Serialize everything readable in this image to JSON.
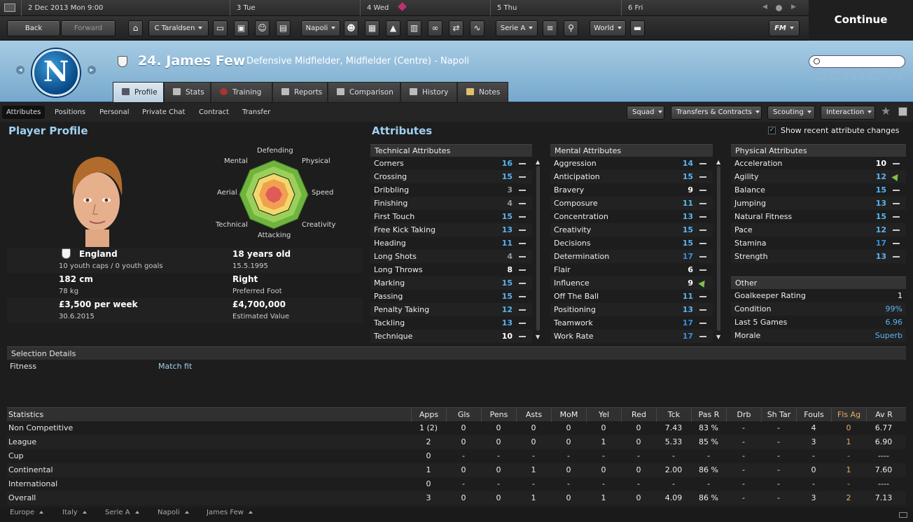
{
  "datebar": {
    "current": "2 Dec 2013 Mon 9:00",
    "days": [
      "3 Tue",
      "4 Wed",
      "5 Thu",
      "6 Fri"
    ]
  },
  "toolbar": {
    "back": "Back",
    "forward": "Forward",
    "manager": "C Taraldsen",
    "club": "Napoli",
    "league": "Serie A",
    "world": "World",
    "fm": "FM",
    "continue": "Continue"
  },
  "player": {
    "title": "24. James Few",
    "subtitle": "Defensive Midfielder, Midfielder (Centre) - Napoli",
    "club_initial": "N",
    "watermark": "SERIE A"
  },
  "tabs": [
    {
      "label": "Profile",
      "active": true
    },
    {
      "label": "Stats"
    },
    {
      "label": "Training"
    },
    {
      "label": "Reports"
    },
    {
      "label": "Comparison"
    },
    {
      "label": "History"
    },
    {
      "label": "Notes"
    }
  ],
  "subnav": [
    "Attributes",
    "Positions",
    "Personal",
    "Private Chat",
    "Contract",
    "Transfer"
  ],
  "subnav_buttons": [
    "Squad",
    "Transfers & Contracts",
    "Scouting",
    "Interaction"
  ],
  "profile": {
    "heading": "Player Profile",
    "radar_labels": {
      "defending": "Defending",
      "physical": "Physical",
      "speed": "Speed",
      "creativity": "Creativity",
      "attacking": "Attacking",
      "technical": "Technical",
      "aerial": "Aerial",
      "mental": "Mental"
    },
    "nationality": "England",
    "caps": "10 youth caps / 0 youth goals",
    "age": "18 years old",
    "dob": "15.5.1995",
    "height": "182 cm",
    "weight": "78 kg",
    "foot": "Right",
    "foot_label": "Preferred Foot",
    "wage": "£3,500 per week",
    "contract_end": "30.6.2015",
    "value": "£4,700,000",
    "value_label": "Estimated Value"
  },
  "attributes": {
    "heading": "Attributes",
    "show_changes": "Show recent attribute changes",
    "technical": {
      "title": "Technical Attributes",
      "rows": [
        {
          "name": "Corners",
          "value": "16",
          "color": "#5ab4f0",
          "trend": "flat"
        },
        {
          "name": "Crossing",
          "value": "15",
          "color": "#5ab4f0",
          "trend": "flat"
        },
        {
          "name": "Dribbling",
          "value": "3",
          "color": "#999999",
          "trend": "flat"
        },
        {
          "name": "Finishing",
          "value": "4",
          "color": "#999999",
          "trend": "flat"
        },
        {
          "name": "First Touch",
          "value": "15",
          "color": "#5ab4f0",
          "trend": "flat"
        },
        {
          "name": "Free Kick Taking",
          "value": "13",
          "color": "#5ab4f0",
          "trend": "flat"
        },
        {
          "name": "Heading",
          "value": "11",
          "color": "#5ab4f0",
          "trend": "flat"
        },
        {
          "name": "Long Shots",
          "value": "4",
          "color": "#999999",
          "trend": "flat"
        },
        {
          "name": "Long Throws",
          "value": "8",
          "color": "#ffffff",
          "trend": "flat"
        },
        {
          "name": "Marking",
          "value": "15",
          "color": "#5ab4f0",
          "trend": "flat"
        },
        {
          "name": "Passing",
          "value": "15",
          "color": "#5ab4f0",
          "trend": "flat"
        },
        {
          "name": "Penalty Taking",
          "value": "12",
          "color": "#5ab4f0",
          "trend": "flat"
        },
        {
          "name": "Tackling",
          "value": "13",
          "color": "#5ab4f0",
          "trend": "flat"
        },
        {
          "name": "Technique",
          "value": "10",
          "color": "#ffffff",
          "trend": "flat"
        }
      ]
    },
    "mental": {
      "title": "Mental Attributes",
      "rows": [
        {
          "name": "Aggression",
          "value": "14",
          "color": "#5ab4f0",
          "trend": "flat"
        },
        {
          "name": "Anticipation",
          "value": "15",
          "color": "#5ab4f0",
          "trend": "flat"
        },
        {
          "name": "Bravery",
          "value": "9",
          "color": "#ffffff",
          "trend": "flat"
        },
        {
          "name": "Composure",
          "value": "11",
          "color": "#5ab4f0",
          "trend": "flat"
        },
        {
          "name": "Concentration",
          "value": "13",
          "color": "#5ab4f0",
          "trend": "flat"
        },
        {
          "name": "Creativity",
          "value": "15",
          "color": "#5ab4f0",
          "trend": "flat"
        },
        {
          "name": "Decisions",
          "value": "15",
          "color": "#5ab4f0",
          "trend": "flat"
        },
        {
          "name": "Determination",
          "value": "17",
          "color": "#3a8ee0",
          "trend": "flat"
        },
        {
          "name": "Flair",
          "value": "6",
          "color": "#ffffff",
          "trend": "flat"
        },
        {
          "name": "Influence",
          "value": "9",
          "color": "#ffffff",
          "trend": "up"
        },
        {
          "name": "Off The Ball",
          "value": "11",
          "color": "#5ab4f0",
          "trend": "flat"
        },
        {
          "name": "Positioning",
          "value": "13",
          "color": "#5ab4f0",
          "trend": "flat"
        },
        {
          "name": "Teamwork",
          "value": "17",
          "color": "#3a8ee0",
          "trend": "flat"
        },
        {
          "name": "Work Rate",
          "value": "17",
          "color": "#3a8ee0",
          "trend": "flat"
        }
      ]
    },
    "physical": {
      "title": "Physical Attributes",
      "rows": [
        {
          "name": "Acceleration",
          "value": "10",
          "color": "#ffffff",
          "trend": "flat"
        },
        {
          "name": "Agility",
          "value": "12",
          "color": "#5ab4f0",
          "trend": "up"
        },
        {
          "name": "Balance",
          "value": "15",
          "color": "#5ab4f0",
          "trend": "flat"
        },
        {
          "name": "Jumping",
          "value": "13",
          "color": "#5ab4f0",
          "trend": "flat"
        },
        {
          "name": "Natural Fitness",
          "value": "15",
          "color": "#5ab4f0",
          "trend": "flat"
        },
        {
          "name": "Pace",
          "value": "12",
          "color": "#5ab4f0",
          "trend": "flat"
        },
        {
          "name": "Stamina",
          "value": "17",
          "color": "#3a8ee0",
          "trend": "flat"
        },
        {
          "name": "Strength",
          "value": "13",
          "color": "#5ab4f0",
          "trend": "flat"
        }
      ]
    },
    "other": {
      "title": "Other",
      "rows": [
        {
          "name": "Goalkeeper Rating",
          "value": "1"
        },
        {
          "name": "Condition",
          "value": "99%"
        },
        {
          "name": "Last 5 Games",
          "value": "6.96"
        },
        {
          "name": "Morale",
          "value": "Superb"
        }
      ]
    }
  },
  "selection": {
    "title": "Selection Details",
    "fitness_label": "Fitness",
    "fitness_value": "Match fit"
  },
  "statistics": {
    "title": "Statistics",
    "columns": [
      "Apps",
      "Gls",
      "Pens",
      "Asts",
      "MoM",
      "Yel",
      "Red",
      "Tck",
      "Pas R",
      "Drb",
      "Sh Tar",
      "Fouls",
      "Fls Ag",
      "Av R"
    ],
    "rows": [
      {
        "name": "Non Competitive",
        "cells": [
          "1 (2)",
          "0",
          "0",
          "0",
          "0",
          "0",
          "0",
          "7.43",
          "83 %",
          "-",
          "-",
          "4",
          "0",
          "6.77"
        ]
      },
      {
        "name": "League",
        "cells": [
          "2",
          "0",
          "0",
          "0",
          "0",
          "1",
          "0",
          "5.33",
          "85 %",
          "-",
          "-",
          "3",
          "1",
          "6.90"
        ]
      },
      {
        "name": "Cup",
        "cells": [
          "0",
          "-",
          "-",
          "-",
          "-",
          "-",
          "-",
          "-",
          "-",
          "-",
          "-",
          "-",
          "-",
          "----"
        ]
      },
      {
        "name": "Continental",
        "cells": [
          "1",
          "0",
          "0",
          "1",
          "0",
          "0",
          "0",
          "2.00",
          "86 %",
          "-",
          "-",
          "0",
          "1",
          "7.60"
        ]
      },
      {
        "name": "International",
        "cells": [
          "0",
          "-",
          "-",
          "-",
          "-",
          "-",
          "-",
          "-",
          "-",
          "-",
          "-",
          "-",
          "-",
          "----"
        ]
      },
      {
        "name": "Overall",
        "cells": [
          "3",
          "0",
          "0",
          "1",
          "0",
          "1",
          "0",
          "4.09",
          "86 %",
          "-",
          "-",
          "3",
          "2",
          "7.13"
        ]
      }
    ]
  },
  "footer": [
    "Europe",
    "Italy",
    "Serie A",
    "Napoli",
    "James Few"
  ]
}
